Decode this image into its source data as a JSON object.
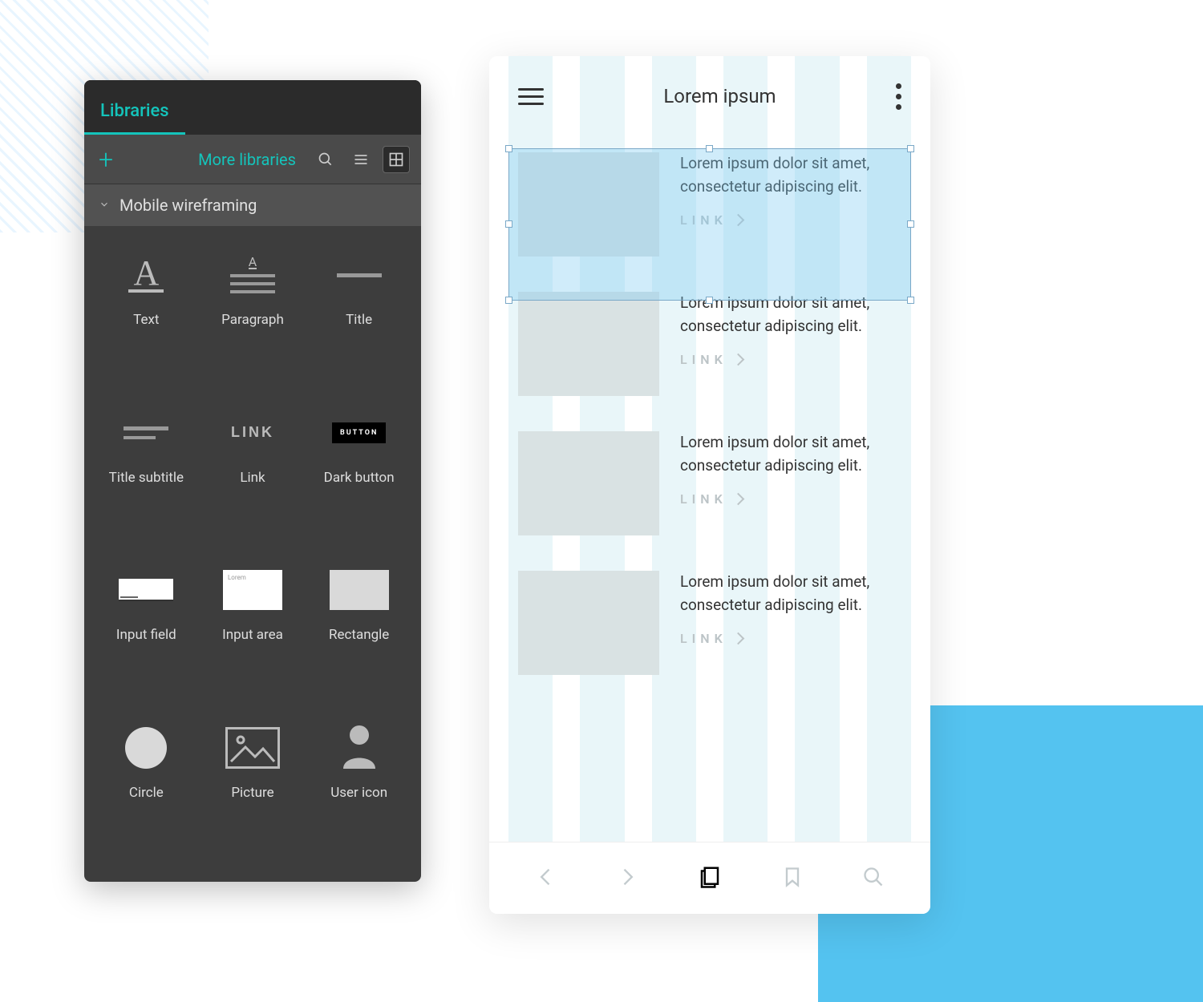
{
  "panel": {
    "tab_label": "Libraries",
    "more_libraries_label": "More libraries",
    "category_label": "Mobile wireframing",
    "inputarea_placeholder": "Lorem",
    "widgets": [
      {
        "label": "Text"
      },
      {
        "label": "Paragraph"
      },
      {
        "label": "Title"
      },
      {
        "label": "Title subtitle"
      },
      {
        "label": "Link"
      },
      {
        "label": "Dark button"
      },
      {
        "label": "Input field"
      },
      {
        "label": "Input area"
      },
      {
        "label": "Rectangle"
      },
      {
        "label": "Circle"
      },
      {
        "label": "Picture"
      },
      {
        "label": "User icon"
      }
    ],
    "preview_text": {
      "letter_a": "A",
      "link_word": "LINK",
      "button_word": "BUTTON"
    }
  },
  "mobile": {
    "title": "Lorem ipsum",
    "card_text": "Lorem ipsum dolor sit amet, consectetur adipiscing elit.",
    "link_label": "LINK",
    "cards_count": 4
  }
}
